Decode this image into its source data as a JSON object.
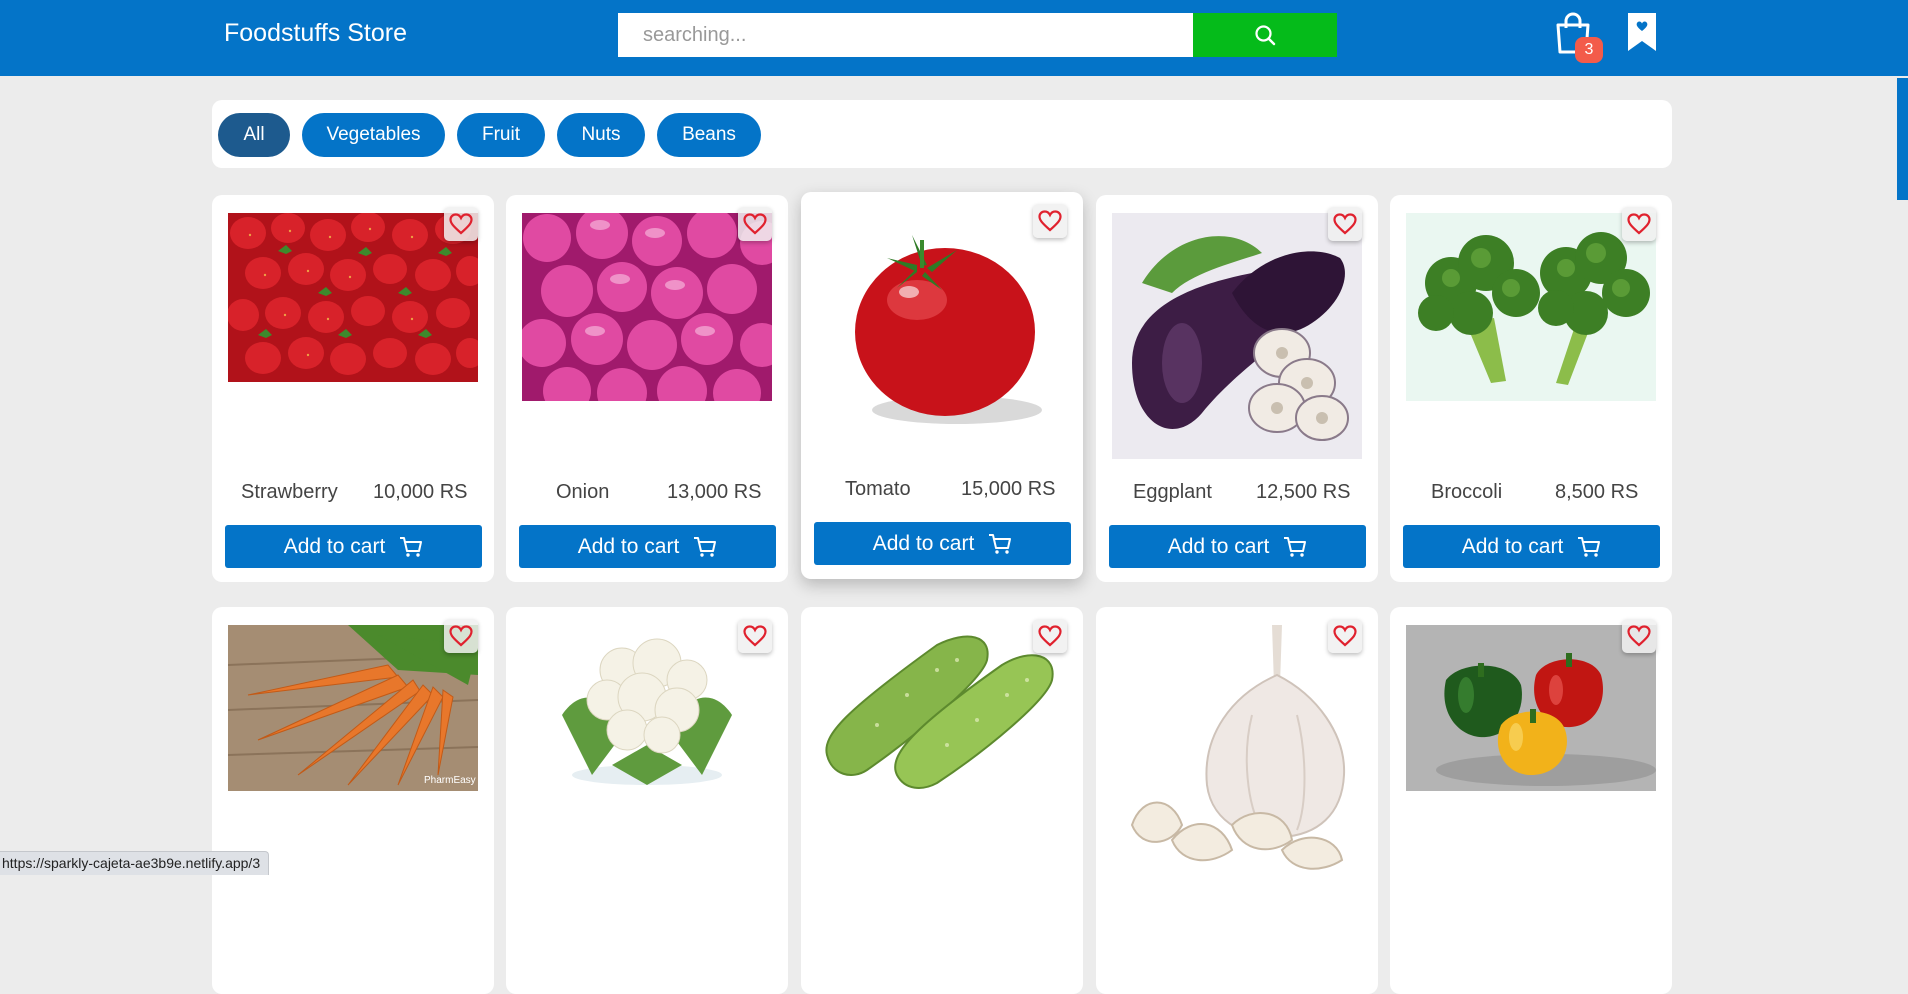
{
  "header": {
    "brand": "Foodstuffs Store",
    "search_placeholder": "searching...",
    "cart_count": "3"
  },
  "filters": [
    "All",
    "Vegetables",
    "Fruit",
    "Nuts",
    "Beans"
  ],
  "active_filter": "All",
  "products": [
    {
      "name": "Strawberry",
      "price": "10,000 RS",
      "button": "Add to cart",
      "image": "strawberry"
    },
    {
      "name": "Onion",
      "price": "13,000 RS",
      "button": "Add to cart",
      "image": "onion"
    },
    {
      "name": "Tomato",
      "price": "15,000 RS",
      "button": "Add to cart",
      "image": "tomato"
    },
    {
      "name": "Eggplant",
      "price": "12,500 RS",
      "button": "Add to cart",
      "image": "eggplant"
    },
    {
      "name": "Broccoli",
      "price": "8,500 RS",
      "button": "Add to cart",
      "image": "broccoli"
    },
    {
      "image": "carrot",
      "image_watermark": "PharmEasy"
    },
    {
      "image": "cauliflower"
    },
    {
      "image": "cucumber"
    },
    {
      "image": "garlic"
    },
    {
      "image": "bell-peppers"
    }
  ],
  "colors": {
    "primary": "#0474c8",
    "active_chip": "#1d5a8e",
    "search_button": "#05bb1a",
    "badge": "#f35b4a",
    "heart": "#e0212e"
  },
  "status_bar": {
    "url": "https://sparkly-cajeta-ae3b9e.netlify.app/3"
  }
}
